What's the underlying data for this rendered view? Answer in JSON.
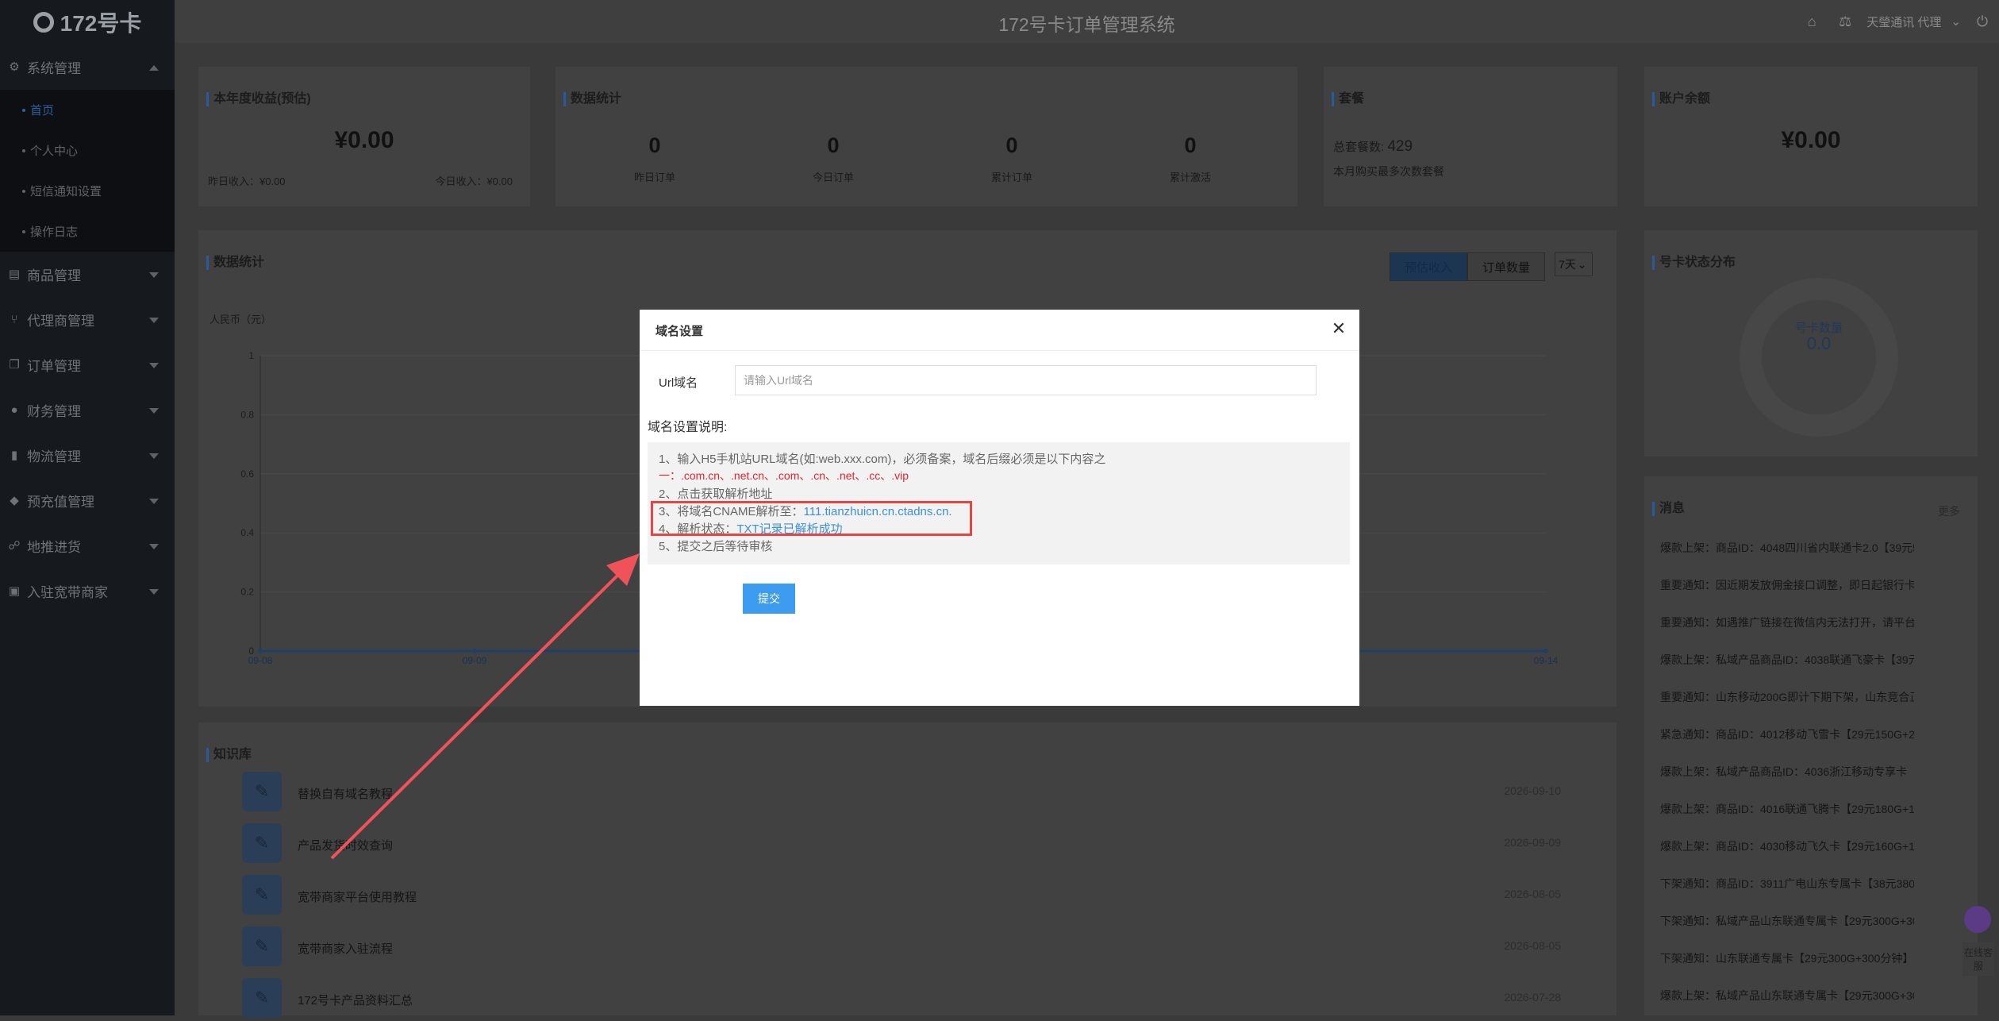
{
  "app": {
    "logo_text": "172号卡",
    "system_title": "172号卡订单管理系统",
    "user_label": "天瑩通讯 代理"
  },
  "sidebar": {
    "groups": [
      {
        "label": "系统管理",
        "icon": "gear-icon",
        "expanded": true
      },
      {
        "label": "商品管理",
        "icon": "book-icon"
      },
      {
        "label": "代理商管理",
        "icon": "network-icon"
      },
      {
        "label": "订单管理",
        "icon": "copy-icon"
      },
      {
        "label": "财务管理",
        "icon": "coin-icon"
      },
      {
        "label": "物流管理",
        "icon": "bookmark-icon"
      },
      {
        "label": "预充值管理",
        "icon": "tag-icon"
      },
      {
        "label": "地推进货",
        "icon": "group-icon"
      },
      {
        "label": "入驻宽带商家",
        "icon": "money-icon"
      }
    ],
    "sub_items": [
      "首页",
      "个人中心",
      "短信通知设置",
      "操作日志"
    ]
  },
  "dashboard": {
    "income_card": {
      "title": "本年度收益(预估)",
      "value": "¥0.00",
      "yesterday": "昨日收入：¥0.00",
      "today": "今日收入：¥0.00"
    },
    "stats_card": {
      "title": "数据统计",
      "items": [
        {
          "value": "0",
          "label": "昨日订单"
        },
        {
          "value": "0",
          "label": "今日订单"
        },
        {
          "value": "0",
          "label": "累计订单"
        },
        {
          "value": "0",
          "label": "累计激活"
        }
      ]
    },
    "package_card": {
      "title": "套餐",
      "count_label": "总套餐数:",
      "count": "429",
      "note": "本月购买最多次数套餐"
    },
    "balance_card": {
      "title": "账户余额",
      "value": "¥0.00"
    },
    "chart_panel": {
      "title": "数据统计",
      "btn_income": "预估收入",
      "btn_orders": "订单数量",
      "range": "7天",
      "ylabel": "人民币（元）"
    },
    "status_panel": {
      "title": "号卡状态分布",
      "center_label": "号卡数量",
      "center_value": "0.0"
    },
    "knowledge": {
      "title": "知识库",
      "items": [
        {
          "title": "替换自有域名教程",
          "date": "2026-09-10"
        },
        {
          "title": "产品发货时效查询",
          "date": "2026-09-09"
        },
        {
          "title": "宽带商家平台使用教程",
          "date": "2026-08-05"
        },
        {
          "title": "宽带商家入驻流程",
          "date": "2026-08-05"
        },
        {
          "title": "172号卡产品资料汇总",
          "date": "2026-07-28"
        }
      ]
    },
    "messages": {
      "title": "消息",
      "more": "更多",
      "items": [
        "爆款上架：商品ID：4048四川省内联通卡2.0【39元5...",
        "重要通知：因近期发放佣金接口调整，即日起银行卡...",
        "重要通知：如遇推广链接在微信内无法打开，请平台...",
        "爆款上架：私域产品商品ID：4038联通飞豪卡【39元...",
        "重要通知：山东移动200G即计下期下架，山东竞合正...",
        "紧急通知：商品ID：4012移动飞雪卡【29元150G+20...",
        "爆款上架：私域产品商品ID：4036浙江移动专享卡【...",
        "爆款上架：商品ID：4016联通飞腾卡【29元180G+10...",
        "爆款上架：商品ID：4030移动飞久卡【29元160G+10...",
        "下架通知：商品ID：3911广电山东专属卡【38元380...",
        "下架通知：私域产品山东联通专属卡【29元300G+30...",
        "下架通知：山东联通专属卡【29元300G+300分钟】",
        "爆款上架：私域产品山东联通专属卡【29元300G+30..."
      ]
    },
    "customer_service": "在线客服"
  },
  "chart_data": {
    "type": "line",
    "x": [
      "09-08",
      "09-09",
      "09-14"
    ],
    "series": [
      {
        "values": [
          0,
          0,
          0
        ]
      }
    ],
    "ylabel": "人民币（元）",
    "ylim": [
      0,
      1
    ],
    "yticks": [
      "1",
      "0.8",
      "0.6",
      "0.4",
      "0.2",
      "0"
    ],
    "grid": true
  },
  "modal": {
    "title": "域名设置",
    "url_label": "Url域名",
    "url_placeholder": "请输入Url域名",
    "url_value": "",
    "desc_title": "域名设置说明:",
    "line1": "1、输入H5手机站URL域名(如:web.xxx.com)，必须备案，域名后缀必须是以下内容之",
    "line1b_prefix": "一：",
    "line1b_suffixes": ".com.cn、.net.cn、.com、.cn、.net、.cc、.vip",
    "line2": "2、点击获取解析地址",
    "line3_label": "3、将域名CNAME解析至：",
    "line3_value": "111.tianzhuicn.cn.ctadns.cn.",
    "line4_label": "4、解析状态：",
    "line4_value": "TXT记录已解析成功",
    "line5": "5、提交之后等待审核",
    "submit": "提交",
    "colors": {
      "highlight": "#e64545",
      "arrow": "#f0525a",
      "primary": "#3d9cf0"
    }
  }
}
